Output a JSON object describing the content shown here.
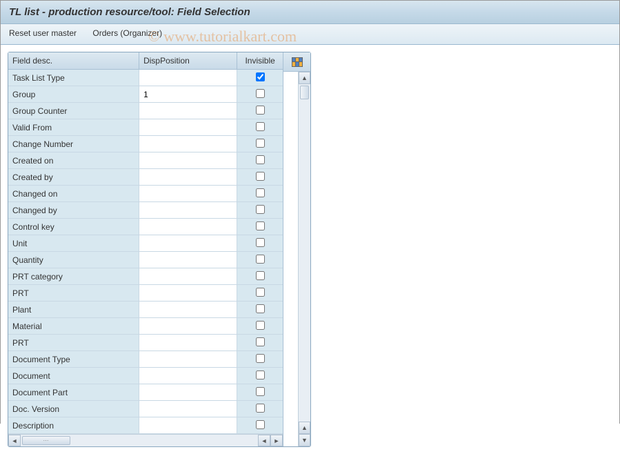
{
  "title": "TL list - production resource/tool: Field Selection",
  "toolbar": {
    "reset_user_master": "Reset user master",
    "orders_organizer": "Orders (Organizer)"
  },
  "watermark": "© www.tutorialkart.com",
  "grid": {
    "headers": {
      "field_desc": "Field desc.",
      "disp_position": "DispPosition",
      "invisible": "Invisible"
    },
    "rows": [
      {
        "label": "Task List Type",
        "disp": "",
        "invisible": true
      },
      {
        "label": "Group",
        "disp": "1",
        "invisible": false
      },
      {
        "label": "Group Counter",
        "disp": "",
        "invisible": false
      },
      {
        "label": "Valid From",
        "disp": "",
        "invisible": false
      },
      {
        "label": "Change Number",
        "disp": "",
        "invisible": false
      },
      {
        "label": "Created on",
        "disp": "",
        "invisible": false
      },
      {
        "label": "Created by",
        "disp": "",
        "invisible": false
      },
      {
        "label": "Changed on",
        "disp": "",
        "invisible": false
      },
      {
        "label": "Changed by",
        "disp": "",
        "invisible": false
      },
      {
        "label": "Control key",
        "disp": "",
        "invisible": false
      },
      {
        "label": "Unit",
        "disp": "",
        "invisible": false
      },
      {
        "label": "Quantity",
        "disp": "",
        "invisible": false
      },
      {
        "label": "PRT category",
        "disp": "",
        "invisible": false
      },
      {
        "label": "PRT",
        "disp": "",
        "invisible": false
      },
      {
        "label": "Plant",
        "disp": "",
        "invisible": false
      },
      {
        "label": "Material",
        "disp": "",
        "invisible": false
      },
      {
        "label": "PRT",
        "disp": "",
        "invisible": false
      },
      {
        "label": "Document Type",
        "disp": "",
        "invisible": false
      },
      {
        "label": "Document",
        "disp": "",
        "invisible": false
      },
      {
        "label": "Document Part",
        "disp": "",
        "invisible": false
      },
      {
        "label": "Doc. Version",
        "disp": "",
        "invisible": false
      },
      {
        "label": "Description",
        "disp": "",
        "invisible": false
      }
    ]
  }
}
